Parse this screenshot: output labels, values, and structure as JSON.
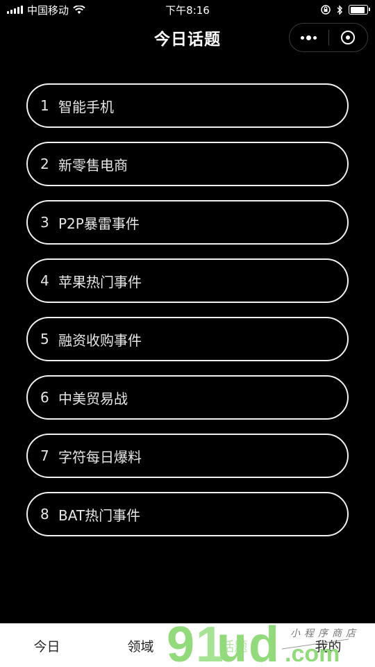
{
  "status": {
    "carrier": "中国移动",
    "time": "下午8:16"
  },
  "nav": {
    "title": "今日话题",
    "more_icon": "more-dots-icon",
    "close_icon": "target-circle-icon"
  },
  "topics": [
    {
      "num": "1",
      "label": "智能手机"
    },
    {
      "num": "2",
      "label": "新零售电商"
    },
    {
      "num": "3",
      "label": "P2P暴雷事件"
    },
    {
      "num": "4",
      "label": "苹果热门事件"
    },
    {
      "num": "5",
      "label": "融资收购事件"
    },
    {
      "num": "6",
      "label": "中美贸易战"
    },
    {
      "num": "7",
      "label": "字符每日爆料"
    },
    {
      "num": "8",
      "label": "BAT热门事件"
    }
  ],
  "tabs": [
    {
      "label": "今日"
    },
    {
      "label": "领域"
    },
    {
      "label": "话题"
    },
    {
      "label": "我的"
    }
  ],
  "watermark": {
    "logo": "91ud.com",
    "tagline": "小程序商店"
  },
  "colors": {
    "background": "#000000",
    "border": "#f2f2f2",
    "tab_bar": "#ffffff",
    "watermark_green": "#7fd36a"
  }
}
